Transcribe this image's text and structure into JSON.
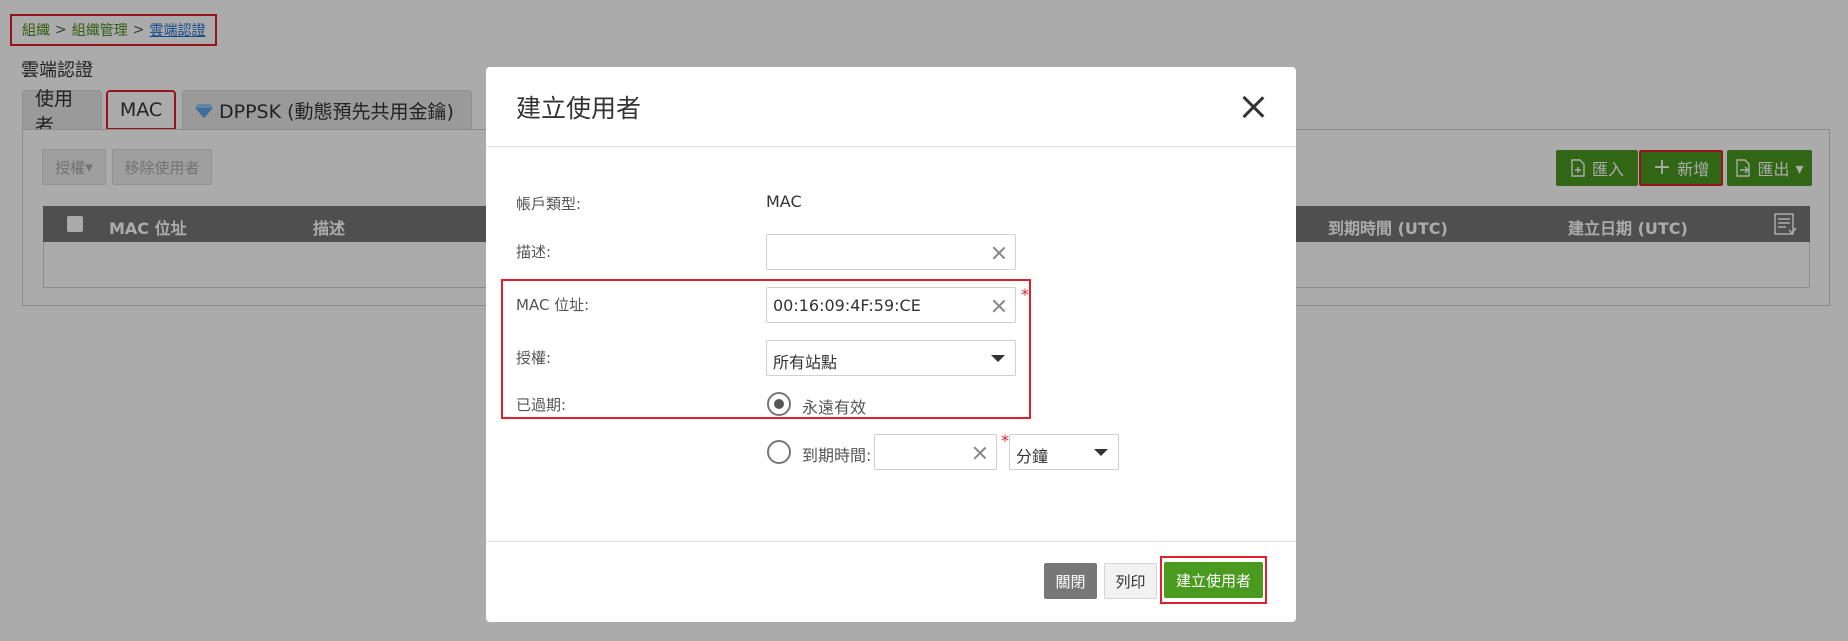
{
  "breadcrumb": {
    "org": "組織",
    "org_manage": "組織管理",
    "current": "雲端認證",
    "sep": ">"
  },
  "page_title": "雲端認證",
  "tabs": {
    "users": "使用者",
    "mac": "MAC",
    "dppsk": "DPPSK (動態預先共用金鑰)"
  },
  "toolbar": {
    "authorize": "授權",
    "remove_users": "移除使用者",
    "import": "匯入",
    "add": "新增",
    "export": "匯出"
  },
  "table": {
    "columns": [
      "MAC 位址",
      "描述",
      "到期時間 (UTC)",
      "建立日期 (UTC)"
    ]
  },
  "modal": {
    "title": "建立使用者",
    "account_type_label": "帳戶類型:",
    "account_type_value": "MAC",
    "description_label": "描述:",
    "description_value": "",
    "mac_label": "MAC 位址:",
    "mac_value": "00:16:09:4F:59:CE",
    "auth_label": "授權:",
    "auth_value": "所有站點",
    "expired_label": "已過期:",
    "forever_label": "永遠有效",
    "expire_time_label": "到期時間:",
    "expire_unit": "分鐘",
    "required_mark": "*",
    "close_button": "關閉",
    "print_button": "列印",
    "create_button": "建立使用者"
  },
  "colors": {
    "accent_green": "#4a9a1f",
    "highlight_red": "#e0202b",
    "link_blue": "#1f6fd1"
  }
}
